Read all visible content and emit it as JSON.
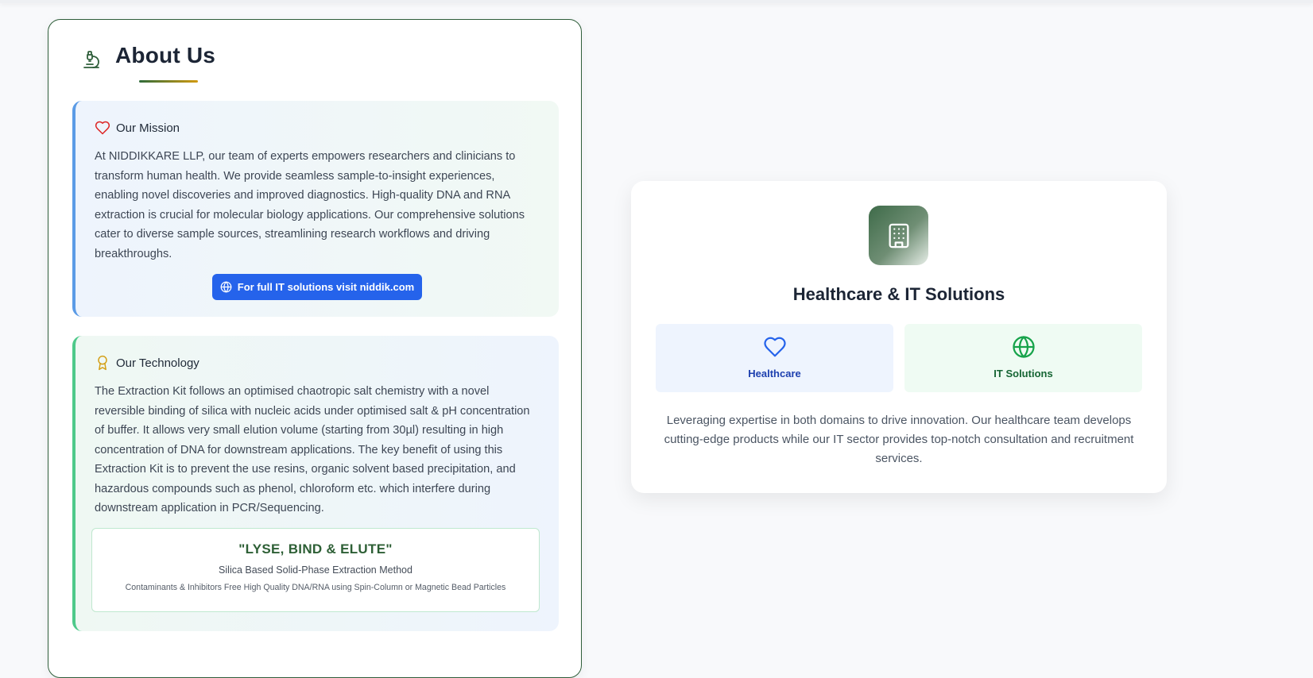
{
  "colors": {
    "accent_green": "#2f5e3a",
    "button_blue": "#2563eb",
    "heart_red": "#dc2626",
    "award_gold": "#d4a017",
    "healthcare_blue": "#1e40af",
    "it_green": "#166534"
  },
  "about": {
    "icon": "microscope-icon",
    "title": "About Us",
    "mission": {
      "icon": "heart-icon",
      "title": "Our Mission",
      "body": "At NIDDIKKARE LLP, our team of experts empowers researchers and clinicians to transform human health. We provide seamless sample-to-insight experiences, enabling novel discoveries and improved diagnostics. High-quality DNA and RNA extraction is crucial for molecular biology applications. Our comprehensive solutions cater to diverse sample sources, streamlining research workflows and driving breakthroughs.",
      "button": {
        "icon": "globe-icon",
        "label": "For full IT solutions visit niddik.com"
      }
    },
    "technology": {
      "icon": "award-icon",
      "title": "Our Technology",
      "body": "The Extraction Kit follows an optimised chaotropic salt chemistry with a novel reversible binding of silica with nucleic acids under optimised salt & pH concentration of buffer. It allows very small elution volume (starting from 30µl) resulting in high concentration of DNA for downstream applications. The key benefit of using this Extraction Kit is to prevent the use resins, organic solvent based precipitation, and hazardous compounds such as phenol, chloroform etc. which interfere during downstream application in PCR/Sequencing.",
      "highlight": {
        "title": "\"LYSE, BIND & ELUTE\"",
        "subtitle": "Silica Based Solid-Phase Extraction Method",
        "note": "Contaminants & Inhibitors Free High Quality DNA/RNA using Spin-Column or Magnetic Bead Particles"
      }
    }
  },
  "solutions": {
    "icon": "building-icon",
    "title": "Healthcare & IT Solutions",
    "tiles": [
      {
        "icon": "heart-icon",
        "label": "Healthcare"
      },
      {
        "icon": "globe-icon",
        "label": "IT Solutions"
      }
    ],
    "description": "Leveraging expertise in both domains to drive innovation. Our healthcare team develops cutting-edge products while our IT sector provides top-notch consultation and recruitment services."
  }
}
